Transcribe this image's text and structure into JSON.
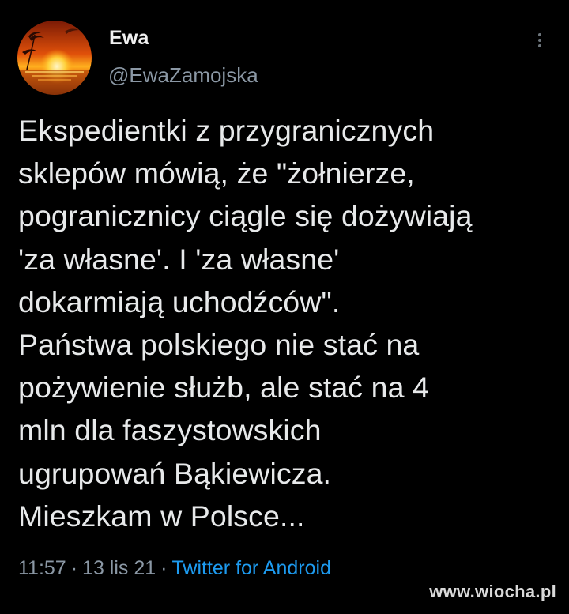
{
  "author": {
    "display_name": "Ewa",
    "handle": "@EwaZamojska",
    "avatar_icon": "sunset-palm-icon"
  },
  "more_icon": "vertical-dots-icon",
  "tweet": {
    "lines": [
      "Ekspedientki z przygranicznych",
      "sklepów mówią, że \"żołnierze,",
      "pogranicznicy ciągle się dożywiają",
      "'za własne'. I 'za własne'",
      "dokarmiają uchodźców\".",
      "Państwa polskiego nie stać na",
      "pożywienie służb, ale stać na 4",
      "mln dla faszystowskich",
      "ugrupowań Bąkiewicza.",
      "Mieszkam w Polsce..."
    ]
  },
  "meta": {
    "time": "11:57",
    "date": "13 lis 21",
    "separator": "·",
    "source": "Twitter for Android"
  },
  "watermark": "www.wiocha.pl",
  "colors": {
    "background": "#000000",
    "text": "#e7e9ea",
    "secondary": "#8b98a5",
    "link": "#1d9bf0"
  }
}
